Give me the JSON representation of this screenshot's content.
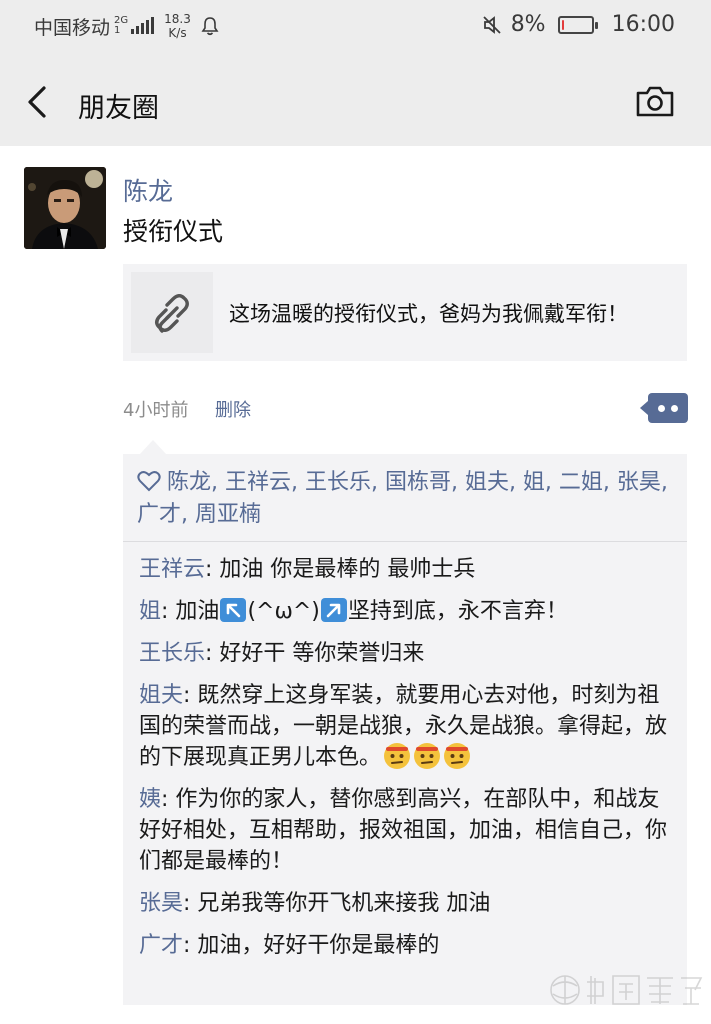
{
  "status_bar": {
    "carrier": "中国移动",
    "network_top": "2G",
    "network_bottom": "1",
    "speed_value": "18.3",
    "speed_unit": "K/s",
    "battery_percent": "8%",
    "battery_level": 0.08,
    "time": "16:00"
  },
  "nav": {
    "title": "朋友圈"
  },
  "post": {
    "author": "陈龙",
    "text": "授衔仪式",
    "link_title": "这场温暖的授衔仪式，爸妈为我佩戴军衔！",
    "time_ago": "4小时前",
    "delete_label": "删除"
  },
  "likes": {
    "names": "陈龙, 王祥云, 王长乐, 国栋哥, 姐夫, 姐, 二姐, 张昊, 广才, 周亚楠"
  },
  "comments": [
    {
      "name": "王祥云",
      "sep": ": ",
      "text": "加油  你是最棒的  最帅士兵"
    },
    {
      "name": "姐",
      "sep": ": ",
      "text_a": "加油",
      "text_b": "(^ω^)",
      "text_c": "坚持到底，永不言弃！"
    },
    {
      "name": "王长乐",
      "sep": ": ",
      "text": "好好干  等你荣誉归来"
    },
    {
      "name": "姐夫",
      "sep": ": ",
      "text": "既然穿上这身军装，就要用心去对他，时刻为祖国的荣誉而战，一朝是战狼，永久是战狼。拿得起，放的下展现真正男儿本色。"
    },
    {
      "name": "姨",
      "sep": ": ",
      "text": "作为你的家人，替你感到高兴，在部队中，和战友好好相处，互相帮助，报效祖国，加油，相信自己，你们都是最棒的！"
    },
    {
      "name": "张昊",
      "sep": ": ",
      "text": "兄弟我等你开飞机来接我 加油"
    },
    {
      "name": "广才",
      "sep": ": ",
      "text": "加油，好好干你是最棒的"
    }
  ],
  "colors": {
    "link_blue": "#576b95",
    "bar_gray": "#ededed",
    "box_gray": "#f3f3f5"
  },
  "icons": [
    "back-icon",
    "camera-icon",
    "link-icon",
    "more-icon",
    "heart-icon",
    "arrow-upleft-emoji",
    "arrow-upright-emoji",
    "determined-face-emoji"
  ]
}
